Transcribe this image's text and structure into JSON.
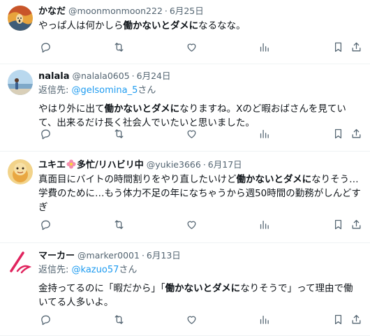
{
  "tweets": [
    {
      "name": "かなだ",
      "handle": "@moonmonmoon222",
      "date": "6月25日",
      "text_pre": "やっぱ人は何かしら",
      "text_bold": "働かないとダメに",
      "text_post": "なるなな。"
    },
    {
      "name": "nalala",
      "handle": "@nalala0605",
      "date": "6月24日",
      "reply_prefix": "返信先:",
      "reply_handle": "@gelsomina_5",
      "reply_suffix": "さん",
      "text_pre": "やはり外に出て",
      "text_bold": "働かないとダメに",
      "text_post": "なりますね。Xのど暇おばさんを見ていて、出来るだけ長く社会人でいたいと思いました。"
    },
    {
      "name_pre": "ユキエ",
      "name_post": "多忙/リハビリ中",
      "handle": "@yukie3666",
      "date": "6月17日",
      "text_pre": "真面目にバイトの時間割りをやり直したいけど",
      "text_bold": "働かないとダメに",
      "text_post": "なりそう…学費のために…もう体力不足の年になちゃうから週50時間の勤務がしんどすぎ"
    },
    {
      "name": "マーカー",
      "handle": "@marker0001",
      "date": "6月13日",
      "reply_prefix": "返信先:",
      "reply_handle": "@kazuo57",
      "reply_suffix": "さん",
      "text_pre": "金持ってるのに「暇だから」「",
      "text_bold": "働かないとダメに",
      "text_post": "なりそうで」って理由で働いてる人多いよ。"
    }
  ],
  "sep": "·",
  "icons": [
    "reply-icon",
    "retweet-icon",
    "like-icon",
    "views-icon",
    "bookmark-icon",
    "share-icon"
  ],
  "colors": {
    "text": "#0f1419",
    "muted": "#536471",
    "link": "#1d9bf0",
    "divider": "#eff3f4"
  }
}
